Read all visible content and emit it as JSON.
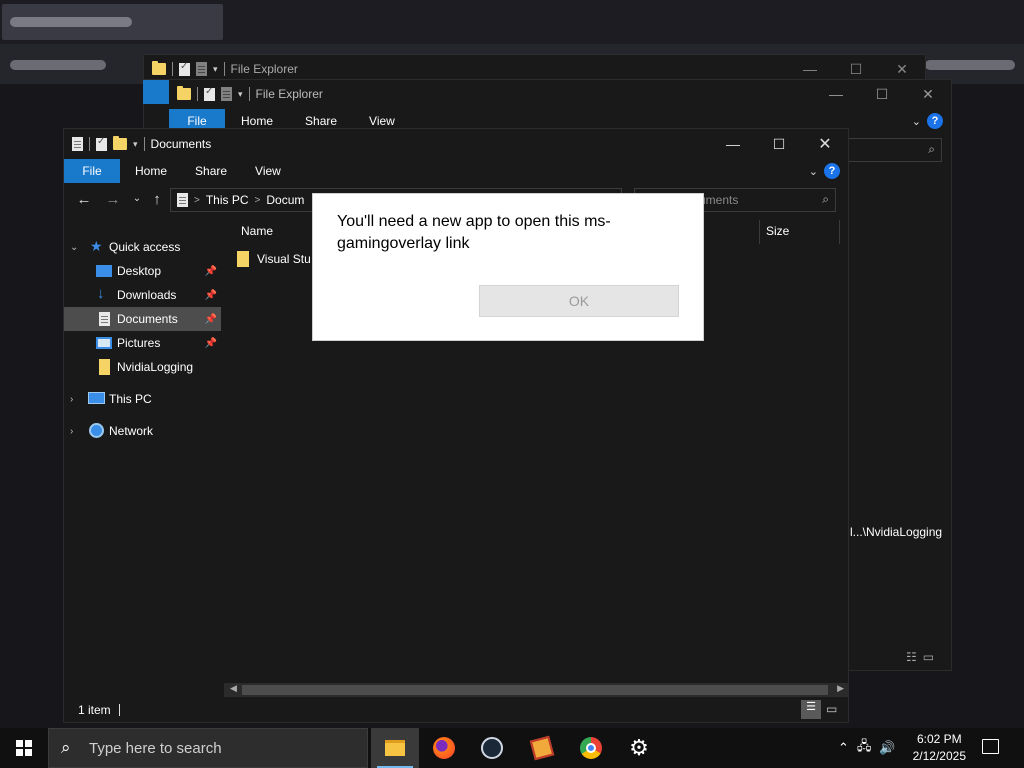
{
  "windows": {
    "back": {
      "title": "File Explorer",
      "caps": [
        "—",
        "☐",
        "✕"
      ]
    },
    "mid": {
      "title": "File Explorer",
      "caps": [
        "—",
        "☐",
        "✕"
      ],
      "tabs": [
        "File",
        "Home",
        "Share",
        "View"
      ],
      "search_fragment": "s",
      "status_path": "l...\\NvidiaLogging"
    },
    "front": {
      "title": "Documents",
      "caps": [
        "—",
        "☐",
        "✕"
      ],
      "tabs": [
        "File",
        "Home",
        "Share",
        "View"
      ],
      "help": "?",
      "address": {
        "crumbs": [
          "This PC",
          "Docum"
        ],
        "sep": ">"
      },
      "search_placeholder": "cuments",
      "nav": {
        "quick_access": "Quick access",
        "items": [
          "Desktop",
          "Downloads",
          "Documents",
          "Pictures",
          "NvidiaLogging"
        ],
        "this_pc": "This PC",
        "network": "Network",
        "selected": "Documents"
      },
      "columns": {
        "name": "Name",
        "size": "Size"
      },
      "files": [
        {
          "name": "Visual Stu"
        }
      ],
      "status": "1 item"
    }
  },
  "dialog": {
    "message": "You'll need a new app to open this ms-gamingoverlay link",
    "ok_label": "OK"
  },
  "taskbar": {
    "search_placeholder": "Type here to search",
    "apps": [
      "file-explorer",
      "firefox",
      "steam",
      "game-app",
      "chrome",
      "settings"
    ],
    "active_app": "file-explorer",
    "time": "6:02 PM",
    "date": "2/12/2025"
  },
  "colors": {
    "accent": "#1979ca",
    "taskbar": "#101010",
    "window_bg": "#191919",
    "dialog_bg": "#ffffff"
  }
}
